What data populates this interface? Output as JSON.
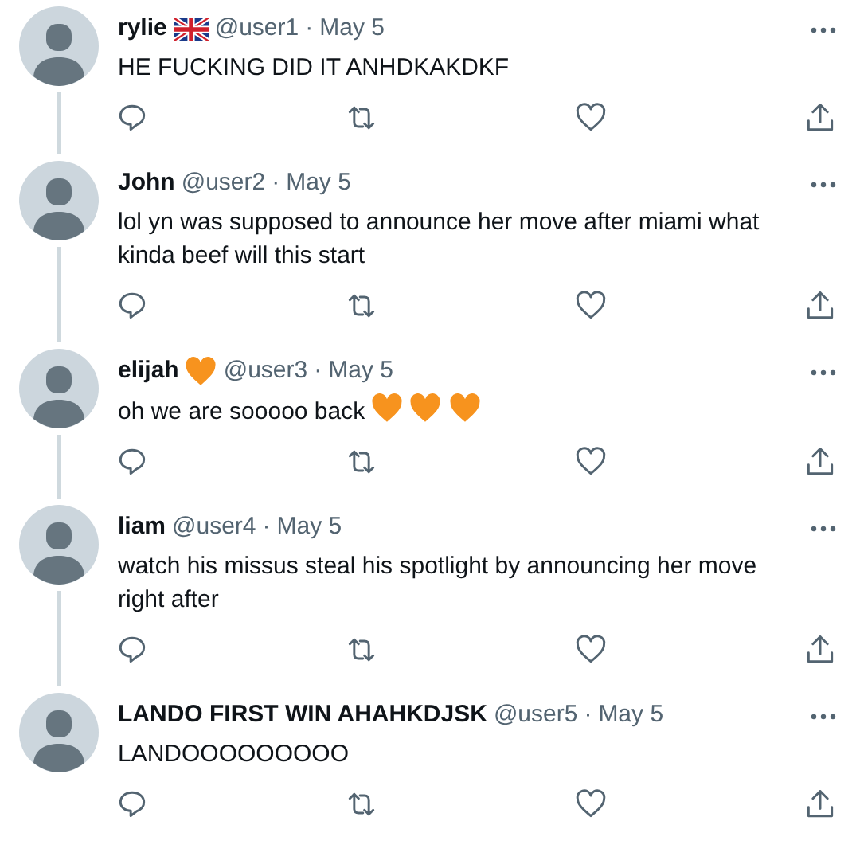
{
  "tweets": [
    {
      "name": "rylie",
      "name_icon": {
        "kind": "flag"
      },
      "handle": "@user1",
      "separator": "·",
      "date": "May 5",
      "text": "HE FUCKING DID IT ANHDKAKDKF",
      "thread_line": true
    },
    {
      "name": "John",
      "handle": "@user2",
      "separator": "·",
      "date": "May 5",
      "text": "lol yn was supposed to announce her move after miami what kinda beef will this start",
      "thread_line": true
    },
    {
      "name": "elijah",
      "name_icon": {
        "kind": "heart"
      },
      "handle": "@user3",
      "separator": "·",
      "date": "May 5",
      "text": "oh we are sooooo back",
      "text_icons": [
        {
          "kind": "heart"
        },
        {
          "kind": "heart"
        },
        {
          "kind": "heart"
        }
      ],
      "thread_line": true
    },
    {
      "name": "liam",
      "handle": "@user4",
      "separator": "·",
      "date": "May 5",
      "text": "watch his missus steal his spotlight by announcing her move right after",
      "thread_line": true
    },
    {
      "name": "LANDO FIRST WIN AHAHKDJSK",
      "handle": "@user5",
      "separator": "·",
      "date": "May 5",
      "text": "LANDOOOOOOOOO",
      "thread_line": false
    }
  ]
}
